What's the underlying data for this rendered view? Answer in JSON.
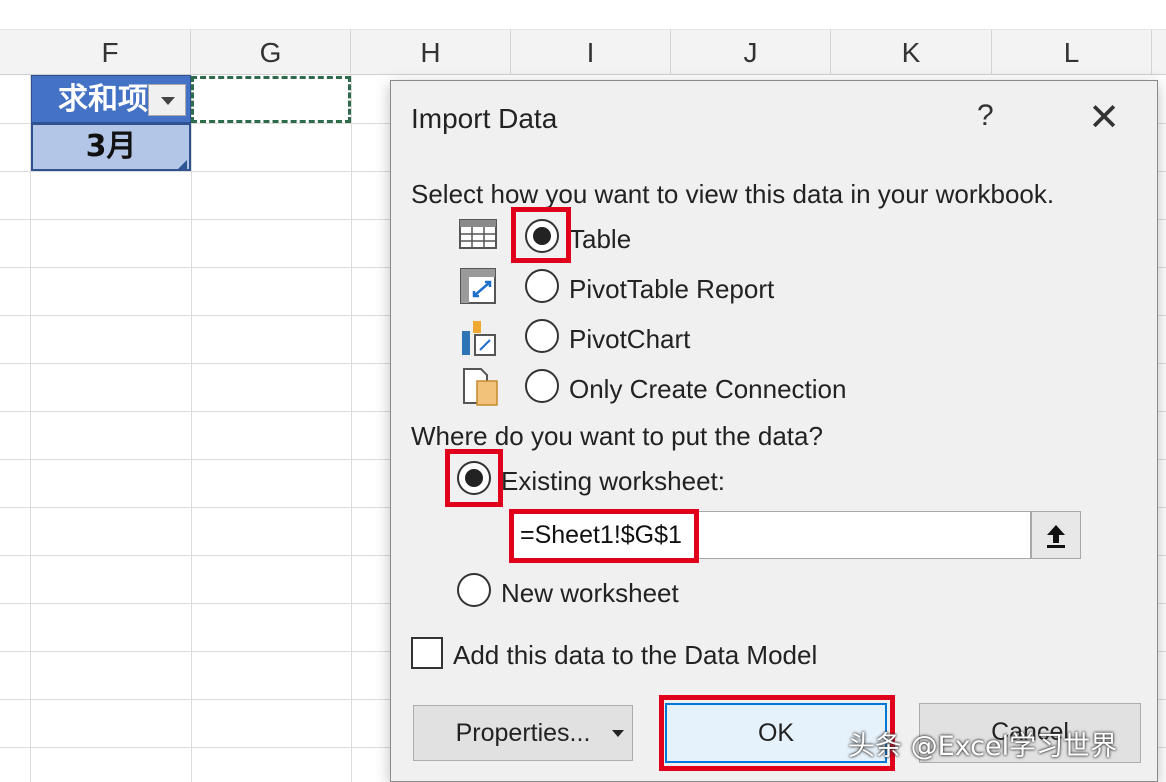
{
  "sheet": {
    "columns": [
      "F",
      "G",
      "H",
      "I",
      "J",
      "K",
      "L"
    ],
    "pivot_header_text": "求和项",
    "pivot_row_value": "3月"
  },
  "dialog": {
    "title": "Import Data",
    "help_label": "?",
    "close_label": "✕",
    "view_prompt": "Select how you want to view this data in your workbook.",
    "view_options": [
      {
        "label": "Table",
        "checked": true,
        "icon": "table-icon"
      },
      {
        "label": "PivotTable Report",
        "checked": false,
        "icon": "pivottable-icon"
      },
      {
        "label": "PivotChart",
        "checked": false,
        "icon": "pivotchart-icon"
      },
      {
        "label": "Only Create Connection",
        "checked": false,
        "icon": "connection-icon"
      }
    ],
    "location_prompt": "Where do you want to put the data?",
    "location_options": [
      {
        "label": "Existing worksheet:",
        "checked": true
      },
      {
        "label": "New worksheet",
        "checked": false
      }
    ],
    "reference_value": "=Sheet1!$G$1",
    "data_model_label": "Add this data to the Data Model",
    "data_model_checked": false,
    "buttons": {
      "properties": "Properties...",
      "ok": "OK",
      "cancel": "Cancel"
    }
  },
  "watermark": "头条 @Excel学习世界",
  "colors": {
    "pivot_header_bg": "#4472c4",
    "pivot_cell_bg": "#b4c6e7",
    "highlight_red": "#e0001b",
    "ok_border": "#0078d7"
  }
}
